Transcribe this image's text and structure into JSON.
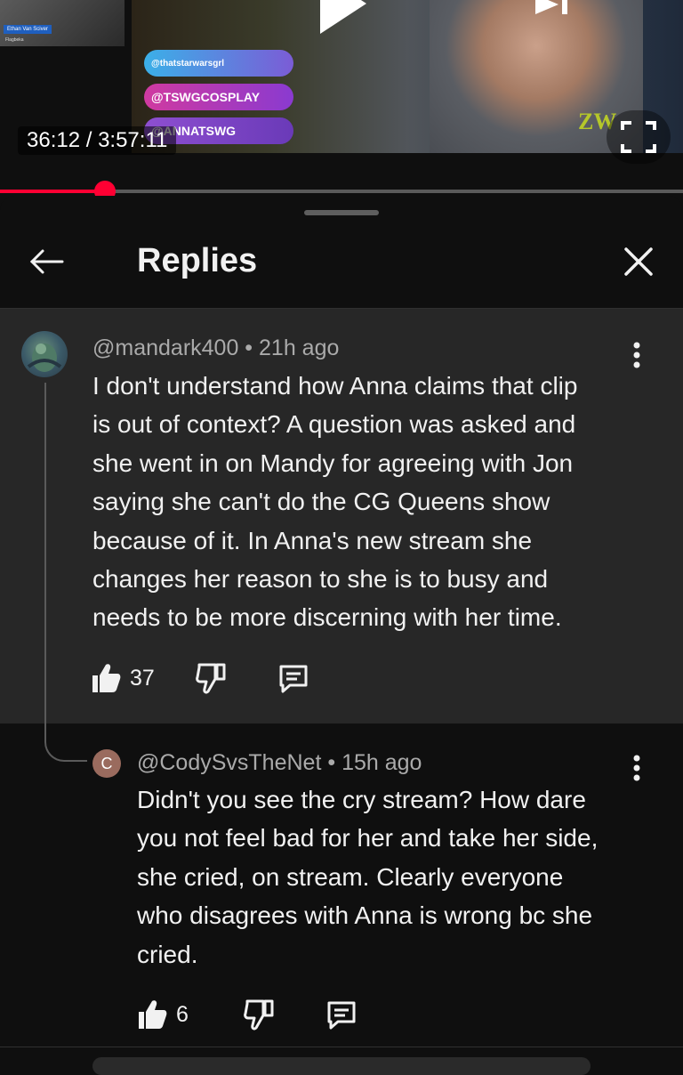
{
  "player": {
    "time_display": "36:12 / 3:57:11",
    "progress_fraction": 0.153,
    "overlay": {
      "webcam_name": "Ethan Van Sciver",
      "webcam_sub": "Flagbeka",
      "twitter": "@thatstarwarsgrl",
      "instagram": "@TSWGCOSPLAY",
      "third": "@ANNATSWG",
      "logo": "ZW"
    }
  },
  "header": {
    "title": "Replies",
    "back_icon": "back-arrow-icon",
    "close_icon": "close-icon"
  },
  "comments": [
    {
      "author": "@mandark400",
      "time": "21h ago",
      "text": "I don't understand how Anna claims that clip\nis out of context? A question was asked and\nshe went in on Mandy for agreeing with Jon\nsaying she can't do the CG Queens show\nbecause of it. In Anna's new stream she\nchanges her reason to she is to busy and\nneeds to be more discerning with her time.",
      "likes": "37"
    },
    {
      "author": "@CodySvsTheNet",
      "avatar_letter": "C",
      "time": "15h ago",
      "text": "Didn't you see the cry stream? How dare\nyou not feel bad for her and take her side,\nshe cried, on stream. Clearly everyone\nwho disagrees with Anna is wrong bc she\ncried.",
      "likes": "6"
    }
  ],
  "colors": {
    "background": "#0f0f0f",
    "highlighted_comment": "#272727",
    "progress": "#ff0033",
    "meta_text": "#aaaaaa"
  }
}
